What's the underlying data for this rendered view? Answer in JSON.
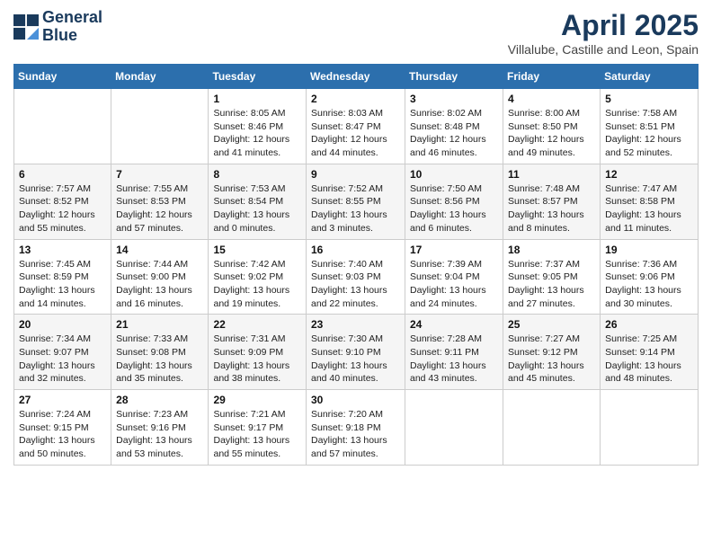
{
  "header": {
    "logo_line1": "General",
    "logo_line2": "Blue",
    "title": "April 2025",
    "subtitle": "Villalube, Castille and Leon, Spain"
  },
  "days_of_week": [
    "Sunday",
    "Monday",
    "Tuesday",
    "Wednesday",
    "Thursday",
    "Friday",
    "Saturday"
  ],
  "weeks": [
    [
      {
        "day": "",
        "info": ""
      },
      {
        "day": "",
        "info": ""
      },
      {
        "day": "1",
        "info": "Sunrise: 8:05 AM\nSunset: 8:46 PM\nDaylight: 12 hours and 41 minutes."
      },
      {
        "day": "2",
        "info": "Sunrise: 8:03 AM\nSunset: 8:47 PM\nDaylight: 12 hours and 44 minutes."
      },
      {
        "day": "3",
        "info": "Sunrise: 8:02 AM\nSunset: 8:48 PM\nDaylight: 12 hours and 46 minutes."
      },
      {
        "day": "4",
        "info": "Sunrise: 8:00 AM\nSunset: 8:50 PM\nDaylight: 12 hours and 49 minutes."
      },
      {
        "day": "5",
        "info": "Sunrise: 7:58 AM\nSunset: 8:51 PM\nDaylight: 12 hours and 52 minutes."
      }
    ],
    [
      {
        "day": "6",
        "info": "Sunrise: 7:57 AM\nSunset: 8:52 PM\nDaylight: 12 hours and 55 minutes."
      },
      {
        "day": "7",
        "info": "Sunrise: 7:55 AM\nSunset: 8:53 PM\nDaylight: 12 hours and 57 minutes."
      },
      {
        "day": "8",
        "info": "Sunrise: 7:53 AM\nSunset: 8:54 PM\nDaylight: 13 hours and 0 minutes."
      },
      {
        "day": "9",
        "info": "Sunrise: 7:52 AM\nSunset: 8:55 PM\nDaylight: 13 hours and 3 minutes."
      },
      {
        "day": "10",
        "info": "Sunrise: 7:50 AM\nSunset: 8:56 PM\nDaylight: 13 hours and 6 minutes."
      },
      {
        "day": "11",
        "info": "Sunrise: 7:48 AM\nSunset: 8:57 PM\nDaylight: 13 hours and 8 minutes."
      },
      {
        "day": "12",
        "info": "Sunrise: 7:47 AM\nSunset: 8:58 PM\nDaylight: 13 hours and 11 minutes."
      }
    ],
    [
      {
        "day": "13",
        "info": "Sunrise: 7:45 AM\nSunset: 8:59 PM\nDaylight: 13 hours and 14 minutes."
      },
      {
        "day": "14",
        "info": "Sunrise: 7:44 AM\nSunset: 9:00 PM\nDaylight: 13 hours and 16 minutes."
      },
      {
        "day": "15",
        "info": "Sunrise: 7:42 AM\nSunset: 9:02 PM\nDaylight: 13 hours and 19 minutes."
      },
      {
        "day": "16",
        "info": "Sunrise: 7:40 AM\nSunset: 9:03 PM\nDaylight: 13 hours and 22 minutes."
      },
      {
        "day": "17",
        "info": "Sunrise: 7:39 AM\nSunset: 9:04 PM\nDaylight: 13 hours and 24 minutes."
      },
      {
        "day": "18",
        "info": "Sunrise: 7:37 AM\nSunset: 9:05 PM\nDaylight: 13 hours and 27 minutes."
      },
      {
        "day": "19",
        "info": "Sunrise: 7:36 AM\nSunset: 9:06 PM\nDaylight: 13 hours and 30 minutes."
      }
    ],
    [
      {
        "day": "20",
        "info": "Sunrise: 7:34 AM\nSunset: 9:07 PM\nDaylight: 13 hours and 32 minutes."
      },
      {
        "day": "21",
        "info": "Sunrise: 7:33 AM\nSunset: 9:08 PM\nDaylight: 13 hours and 35 minutes."
      },
      {
        "day": "22",
        "info": "Sunrise: 7:31 AM\nSunset: 9:09 PM\nDaylight: 13 hours and 38 minutes."
      },
      {
        "day": "23",
        "info": "Sunrise: 7:30 AM\nSunset: 9:10 PM\nDaylight: 13 hours and 40 minutes."
      },
      {
        "day": "24",
        "info": "Sunrise: 7:28 AM\nSunset: 9:11 PM\nDaylight: 13 hours and 43 minutes."
      },
      {
        "day": "25",
        "info": "Sunrise: 7:27 AM\nSunset: 9:12 PM\nDaylight: 13 hours and 45 minutes."
      },
      {
        "day": "26",
        "info": "Sunrise: 7:25 AM\nSunset: 9:14 PM\nDaylight: 13 hours and 48 minutes."
      }
    ],
    [
      {
        "day": "27",
        "info": "Sunrise: 7:24 AM\nSunset: 9:15 PM\nDaylight: 13 hours and 50 minutes."
      },
      {
        "day": "28",
        "info": "Sunrise: 7:23 AM\nSunset: 9:16 PM\nDaylight: 13 hours and 53 minutes."
      },
      {
        "day": "29",
        "info": "Sunrise: 7:21 AM\nSunset: 9:17 PM\nDaylight: 13 hours and 55 minutes."
      },
      {
        "day": "30",
        "info": "Sunrise: 7:20 AM\nSunset: 9:18 PM\nDaylight: 13 hours and 57 minutes."
      },
      {
        "day": "",
        "info": ""
      },
      {
        "day": "",
        "info": ""
      },
      {
        "day": "",
        "info": ""
      }
    ]
  ]
}
